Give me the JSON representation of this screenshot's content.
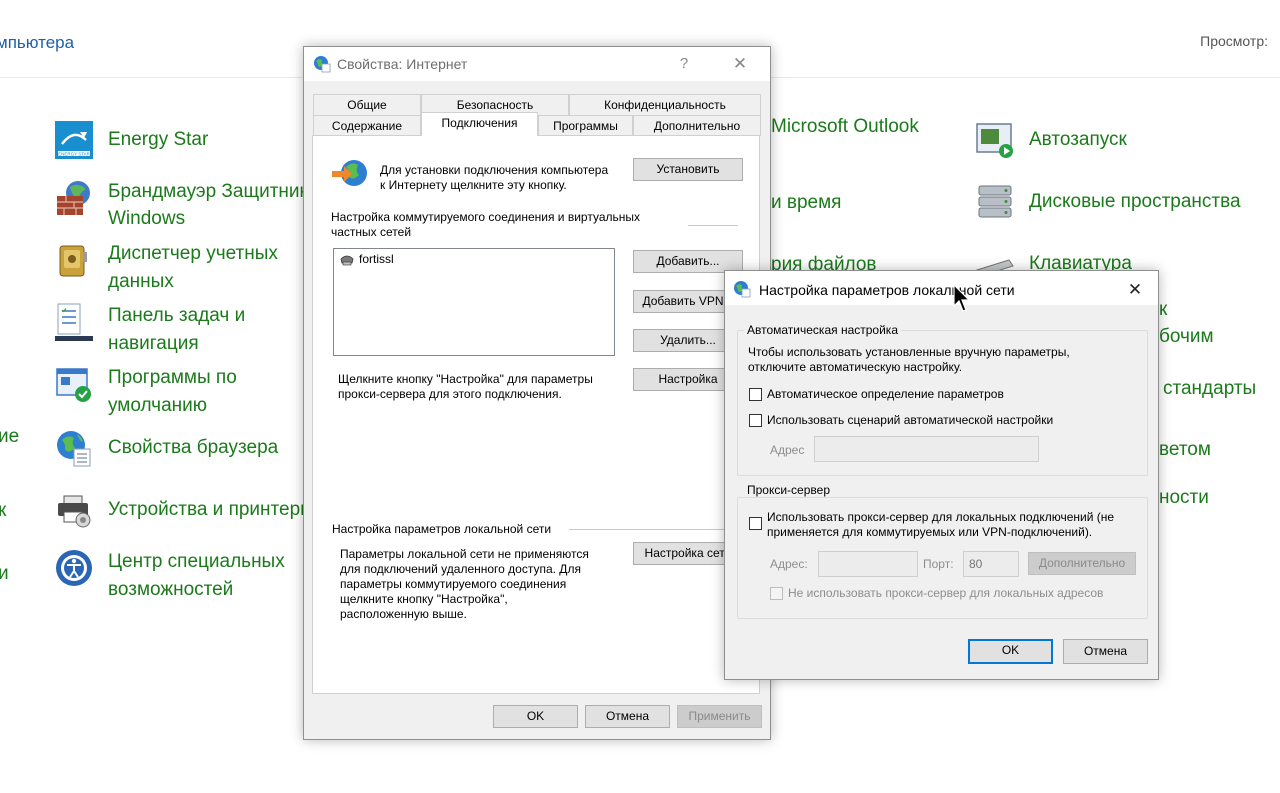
{
  "control_panel": {
    "breadcrumb": "мпьютера",
    "view_label": "Просмотр:",
    "col1": [
      {
        "label": "Energy Star",
        "icon": "energy-star-icon"
      },
      {
        "label": "Брандмауэр Защитника\nWindows",
        "icon": "firewall-icon"
      },
      {
        "label": "Диспетчер учетных\nданных",
        "icon": "credential-manager-icon"
      },
      {
        "label": "Панель задач и\nнавигация",
        "icon": "taskbar-icon"
      },
      {
        "label": "Программы по\nумолчанию",
        "icon": "default-programs-icon"
      },
      {
        "label": "Свойства браузера",
        "icon": "internet-options-icon"
      },
      {
        "label": "Устройства и принтеры",
        "icon": "devices-printers-icon"
      },
      {
        "label": "Центр специальных\nвозможностей",
        "icon": "ease-of-access-icon"
      }
    ],
    "col2_visible": [
      "Microsoft Outlook",
      "и время",
      "рия файлов"
    ],
    "col3": [
      {
        "label": "Автозапуск",
        "icon": "autoplay-icon"
      },
      {
        "label": "Дисковые пространства",
        "icon": "storage-spaces-icon"
      },
      {
        "label": "Клавиатура",
        "icon": "keyboard-icon"
      }
    ],
    "col3_fragments": [
      "к",
      "бочим",
      "стандарты",
      "ветом",
      "ности"
    ],
    "left_fragments": [
      "ие",
      "к",
      "и"
    ]
  },
  "internet_props": {
    "title": "Свойства: Интернет",
    "help_glyph": "?",
    "close_glyph": "✕",
    "tabs_row1": [
      "Общие",
      "Безопасность",
      "Конфиденциальность"
    ],
    "tabs_row2": [
      "Содержание",
      "Подключения",
      "Программы",
      "Дополнительно"
    ],
    "active_tab": "Подключения",
    "setup_text": "Для установки подключения компьютера\nк Интернету щелкните эту кнопку.",
    "setup_button": "Установить",
    "dialup_heading": "Настройка коммутируемого соединения и виртуальных\nчастных сетей",
    "connections": [
      "fortissl"
    ],
    "add_button": "Добавить...",
    "add_vpn_button": "Добавить VPN...",
    "remove_button": "Удалить...",
    "settings_button": "Настройка",
    "proxy_hint": "Щелкните кнопку \"Настройка\" для параметры\nпрокси-сервера для этого подключения.",
    "lan_heading": "Настройка параметров локальной сети",
    "lan_text": "Параметры локальной сети не применяются\nдля подключений удаленного доступа. Для\nпараметры коммутируемого соединения\nщелкните кнопку \"Настройка\",\nрасположенную выше.",
    "lan_button": "Настройка сети",
    "ok": "OK",
    "cancel": "Отмена",
    "apply": "Применить"
  },
  "lan_dialog": {
    "title": "Настройка параметров локальной сети",
    "close_glyph": "✕",
    "auto_group": "Автоматическая настройка",
    "auto_desc": "Чтобы использовать установленные вручную параметры,\nотключите автоматическую настройку.",
    "auto_detect": "Автоматическое определение параметров",
    "use_script": "Использовать сценарий автоматической настройки",
    "address_label": "Адрес",
    "address_value": "",
    "proxy_group": "Прокси-сервер",
    "use_proxy": "Использовать прокси-сервер для локальных подключений (не\nприменяется для коммутируемых или VPN-подключений).",
    "proxy_address_label": "Адрес:",
    "proxy_address_value": "",
    "port_label": "Порт:",
    "port_value": "80",
    "advanced_button": "Дополнительно",
    "bypass_local": "Не использовать прокси-сервер для локальных адресов",
    "ok": "OK",
    "cancel": "Отмена"
  }
}
